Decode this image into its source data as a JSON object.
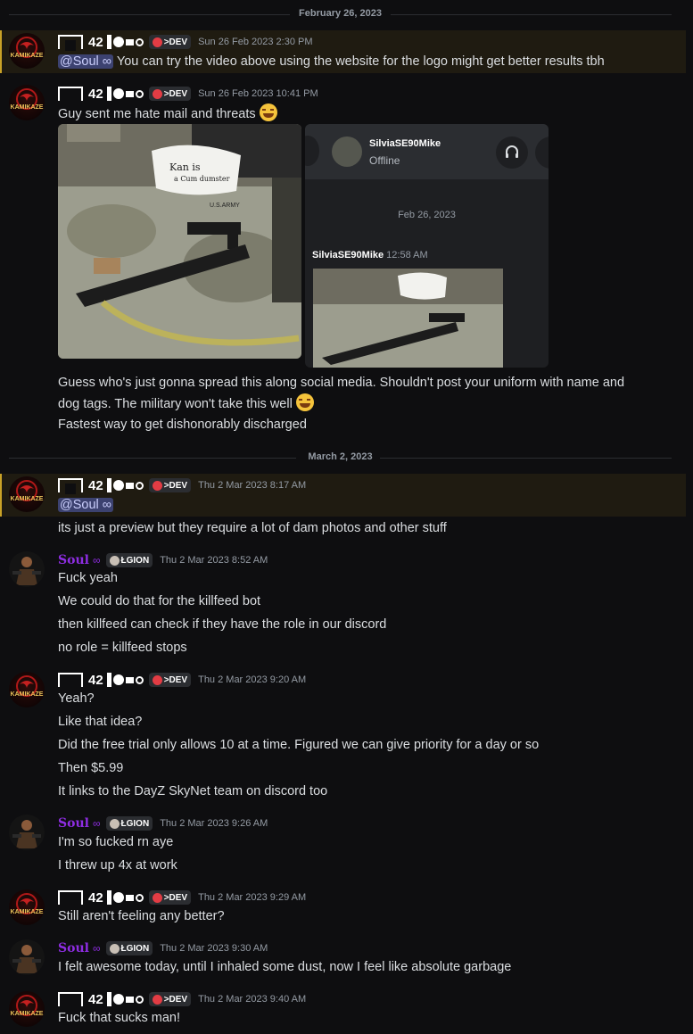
{
  "dividers": [
    "February 26, 2023",
    "March 2, 2023"
  ],
  "users": {
    "dev": {
      "handle": "42",
      "badge": ">DEV"
    },
    "soul": {
      "name": "Soul",
      "infinity": "∞",
      "badge": "ŁGION"
    }
  },
  "messages": {
    "m1": {
      "time": "Sun 26 Feb 2023 2:30 PM",
      "mention": "@Soul ∞",
      "text": " You can try the video above using the website for the logo might get better results tbh"
    },
    "m2": {
      "time": "Sun 26 Feb 2023 10:41 PM",
      "text": "Guy sent me hate mail and threats",
      "line1": "Guess who's just gonna spread this along social media. Shouldn't post your uniform with name and",
      "line2": "dog tags. The military won't take this well",
      "line3": "Fastest way to get dishonorably discharged"
    },
    "m3": {
      "time": "Thu 2 Mar 2023 8:17 AM",
      "mention": "@Soul ∞",
      "text": "its just a preview but they require a lot of dam photos and other stuff"
    },
    "m4": {
      "time": "Thu 2 Mar 2023 8:52 AM",
      "lines": [
        "Fuck yeah",
        "We could do that for the killfeed bot",
        "then killfeed can check if they have the role in our discord",
        "no role = killfeed stops"
      ]
    },
    "m5": {
      "time": "Thu 2 Mar 2023 9:20 AM",
      "lines": [
        "Yeah?",
        "Like that idea?",
        "Did the free trial only allows 10 at a time. Figured we can give priority for a day or so",
        "Then $5.99",
        "It links to the DayZ SkyNet team on discord too"
      ]
    },
    "m6": {
      "time": "Thu 2 Mar 2023 9:26 AM",
      "lines": [
        "I'm so fucked rn aye",
        "I threw up 4x at work"
      ]
    },
    "m7": {
      "time": "Thu 2 Mar 2023 9:29 AM",
      "text": "Still aren't feeling any better?"
    },
    "m8": {
      "time": "Thu 2 Mar 2023 9:30 AM",
      "text": "I felt awesome today, until I inhaled some dust, now I feel like absolute garbage"
    },
    "m9": {
      "time": "Thu 2 Mar 2023 9:40 AM",
      "text": "Fuck that sucks man!"
    }
  },
  "photo_note": {
    "line1": "Kan is",
    "line2": "a Cum dumster",
    "tag": "U.S.ARMY"
  },
  "screenshot": {
    "username": "SilviaSE90Mike",
    "status": "Offline",
    "date": "Feb 26, 2023",
    "msg_user": "SilviaSE90Mike",
    "msg_time": "12:58 AM"
  },
  "logo_text": "KAMIKAZE"
}
